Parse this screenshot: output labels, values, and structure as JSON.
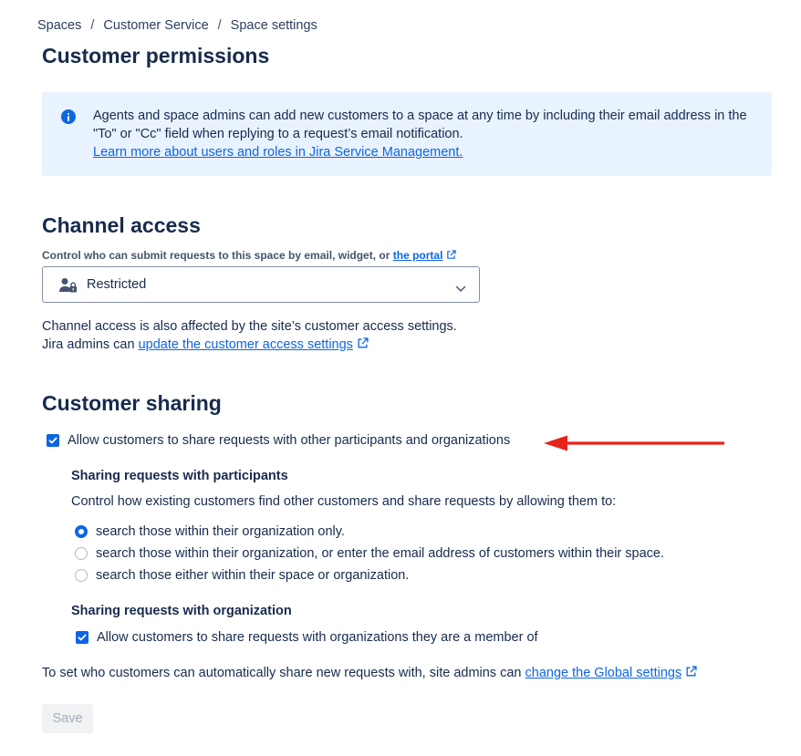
{
  "breadcrumb": [
    "Spaces",
    "Customer Service",
    "Space settings"
  ],
  "page_title": "Customer permissions",
  "banner": {
    "text": "Agents and space admins can add new customers to a space at any time by including their email address in the \"To\" or \"Cc\" field when replying to a request’s email notification.",
    "link": "Learn more about users and roles in Jira Service Management."
  },
  "channel_access": {
    "heading": "Channel access",
    "label_prefix": "Control who can submit requests to this space by email, widget, or",
    "label_link": "the portal",
    "selected_value": "Restricted",
    "note_line1": "Channel access is also affected by the site’s customer access settings.",
    "note_line2_prefix": "Jira admins can",
    "note_link": "update the customer access settings"
  },
  "customer_sharing": {
    "heading": "Customer sharing",
    "allow_checkbox_label": "Allow customers to share requests with other participants and organizations",
    "allow_checked": true,
    "participants_heading": "Sharing requests with participants",
    "participants_desc": "Control how existing customers find other customers and share requests by allowing them to:",
    "radio_options": [
      "search those within their organization only.",
      "search those within their organization, or enter the email address of customers within their space.",
      "search those either within their space or organization."
    ],
    "radio_selected_index": 0,
    "organization_heading": "Sharing requests with organization",
    "org_checkbox_label": "Allow customers to share requests with organizations they are a member of",
    "org_checked": true,
    "global_prefix": "To set who customers can automatically share new requests with, site admins can",
    "global_link": "change the Global settings"
  },
  "save_label": "Save",
  "colors": {
    "accent": "#0c66e4",
    "banner_bg": "#e9f2ff",
    "annotation_arrow": "#e8231b"
  },
  "icons": [
    "info-icon",
    "external-link-icon",
    "restricted-user-icon",
    "chevron-down-icon",
    "checkbox-checked-icon",
    "annotation-arrow"
  ]
}
